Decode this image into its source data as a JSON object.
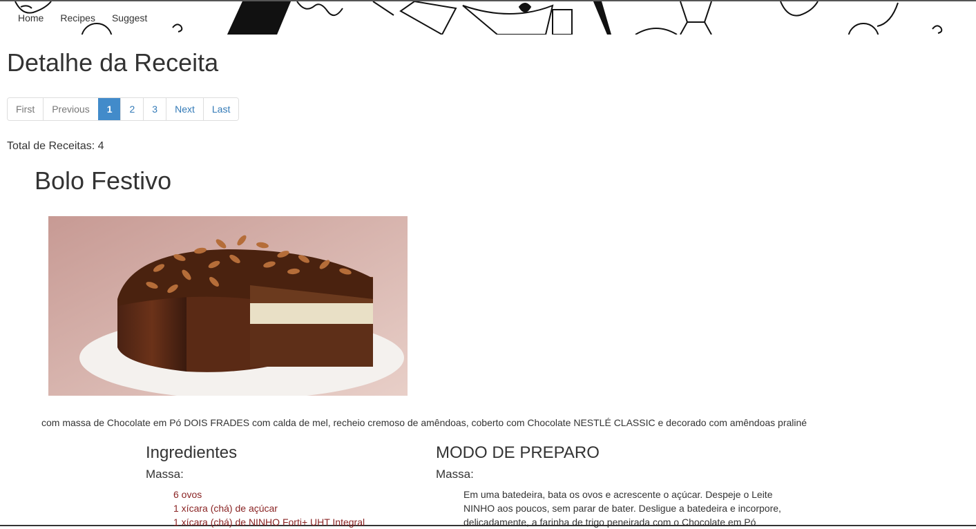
{
  "nav": {
    "items": [
      "Home",
      "Recipes",
      "Suggest"
    ]
  },
  "page": {
    "title": "Detalhe da Receita",
    "total_label": "Total de Receitas: 4"
  },
  "pagination": {
    "first": "First",
    "previous": "Previous",
    "pages": [
      "1",
      "2",
      "3"
    ],
    "active_page": "1",
    "next": "Next",
    "last": "Last"
  },
  "recipe": {
    "title": "Bolo Festivo",
    "description": "com massa de Chocolate em Pó DOIS FRADES com calda de mel, recheio cremoso de amêndoas, coberto com Chocolate NESTLÉ CLASSIC e decorado com amêndoas praliné",
    "ingredients_heading": "Ingredientes",
    "ingredients_subheading": "Massa:",
    "ingredients": [
      "6 ovos",
      "1 xícara (chá) de açúcar",
      "1 xícara (chá) de NINHO Forti+ UHT Integral"
    ],
    "preparation_heading": "MODO DE PREPARO",
    "preparation_subheading": "Massa:",
    "preparation_text": "Em uma batedeira, bata os ovos e acrescente o açúcar. Despeje o Leite NINHO aos poucos, sem parar de bater. Desligue a batedeira e incorpore, delicadamente, a farinha de trigo peneirada com o Chocolate em Pó"
  },
  "colors": {
    "link": "#337ab7",
    "active_page_bg": "#428bca",
    "ingredient_text": "#8a2424"
  }
}
